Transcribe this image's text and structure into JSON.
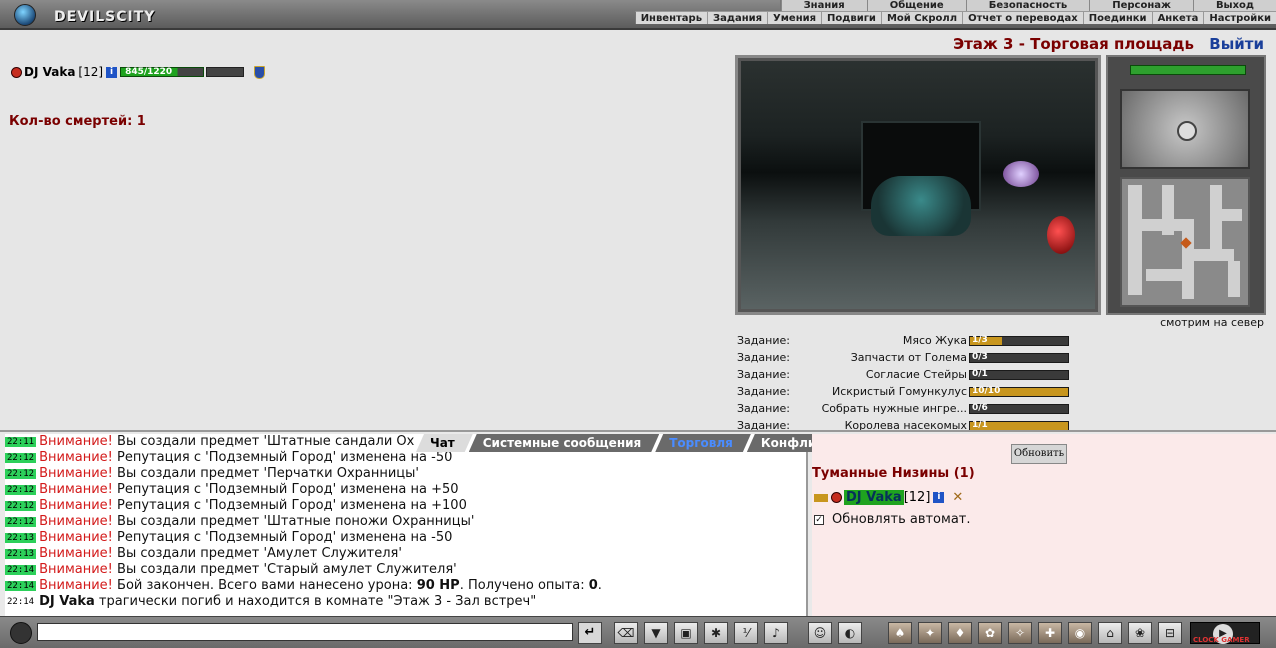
{
  "app": {
    "logo_text": "DEVILSCITY"
  },
  "top_menu": [
    "Знания",
    "Общение",
    "Безопасность",
    "Персонаж",
    "Выход"
  ],
  "sub_menu": [
    "Инвентарь",
    "Задания",
    "Умения",
    "Подвиги",
    "Мой Скролл",
    "Отчет о переводах",
    "Поединки",
    "Анкета",
    "Настройки"
  ],
  "location": {
    "title": "Этаж 3 - Торговая площадь",
    "exit_label": "Выйти",
    "direction": "смотрим на север"
  },
  "player": {
    "name": "DJ Vaka",
    "level": "[12]",
    "info": "i",
    "hp_text": "845/1220",
    "hp_fraction": 0.69
  },
  "deaths": "Кол-во смертей: 1",
  "tasks": [
    {
      "label": "Задание:",
      "name": "Мясо Жука",
      "progress": "1/3",
      "fraction": 0.33
    },
    {
      "label": "Задание:",
      "name": "Запчасти от Голема",
      "progress": "0/3",
      "fraction": 0
    },
    {
      "label": "Задание:",
      "name": "Согласие Стейры",
      "progress": "0/1",
      "fraction": 0
    },
    {
      "label": "Задание:",
      "name": "Искристый Гомункулус",
      "progress": "10/10",
      "fraction": 1
    },
    {
      "label": "Задание:",
      "name": "Собрать нужные ингре...",
      "progress": "0/6",
      "fraction": 0
    },
    {
      "label": "Задание:",
      "name": "Королева насекомых",
      "progress": "1/1",
      "fraction": 1
    }
  ],
  "chat_tabs": [
    "Чат",
    "Системные сообщения",
    "Торговля",
    "Конфликты"
  ],
  "chat": [
    {
      "time": "22:11",
      "warn": "Внимание!",
      "text": " Вы создали предмет 'Штатные сандали Ох"
    },
    {
      "time": "22:12",
      "warn": "Внимание!",
      "text": " Репутация с 'Подземный Город' изменена на -50"
    },
    {
      "time": "22:12",
      "warn": "Внимание!",
      "text": " Вы создали предмет 'Перчатки Охранницы'"
    },
    {
      "time": "22:12",
      "warn": "Внимание!",
      "text": " Репутация с 'Подземный Город' изменена на +50"
    },
    {
      "time": "22:12",
      "warn": "Внимание!",
      "text": " Репутация с 'Подземный Город' изменена на +100"
    },
    {
      "time": "22:12",
      "warn": "Внимание!",
      "text": " Вы создали предмет 'Штатные поножи Охранницы'"
    },
    {
      "time": "22:13",
      "warn": "Внимание!",
      "text": " Репутация с 'Подземный Город' изменена на -50"
    },
    {
      "time": "22:13",
      "warn": "Внимание!",
      "text": " Вы создали предмет 'Амулет Служителя'"
    },
    {
      "time": "22:14",
      "warn": "Внимание!",
      "text": " Вы создали предмет 'Старый амулет Служителя'"
    }
  ],
  "chat_battle": {
    "time": "22:14",
    "warn": "Внимание!",
    "a": " Бой закончен. Всего вами нанесено урона: ",
    "dmg": "90 HP",
    "b": ". Получено опыта: ",
    "exp": "0",
    "c": "."
  },
  "chat_last": {
    "time": "22:14",
    "name": "DJ Vaka",
    "text": " трагически погиб и находится в комнате \"Этаж 3 - Зал встреч\""
  },
  "side": {
    "refresh": "Обновить",
    "zone": "Туманные Низины (1)",
    "member_name": "DJ Vaka",
    "member_level": "[12]",
    "auto_refresh": "Обновлять автомат."
  },
  "toolbar": {
    "send": "↵",
    "clock_label": "CLOCK GAMER"
  }
}
